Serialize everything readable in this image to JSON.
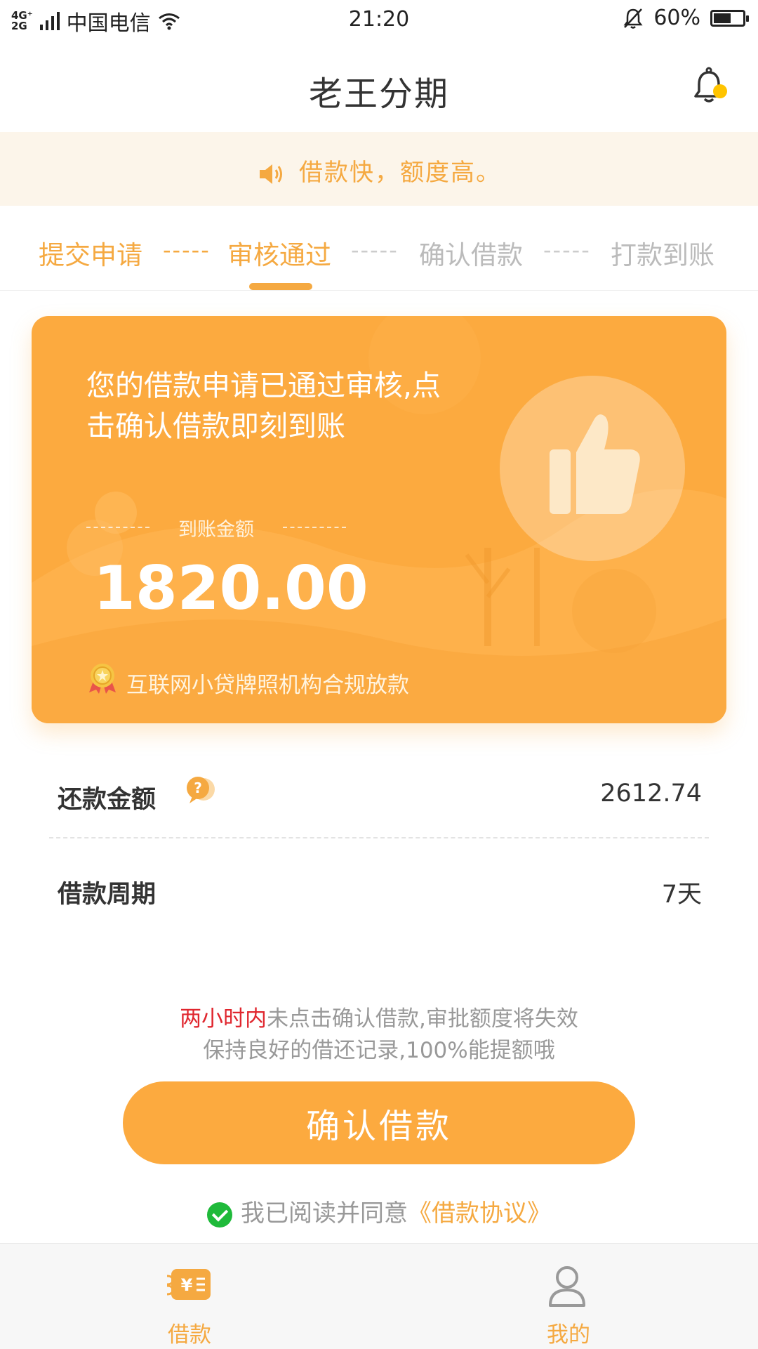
{
  "status_bar": {
    "network_type": "4G⁺\n2G",
    "carrier": "中国电信",
    "time": "21:20",
    "battery": "60%",
    "battery_level": 0.6
  },
  "header": {
    "title": "老王分期"
  },
  "notice": {
    "text": "借款快，额度高。"
  },
  "steps": [
    {
      "label": "提交申请",
      "state": "done"
    },
    {
      "label": "审核通过",
      "state": "done"
    },
    {
      "label": "确认借款",
      "state": "pending"
    },
    {
      "label": "打款到账",
      "state": "pending"
    }
  ],
  "step_separator": "-----",
  "card": {
    "title": "您的借款申请已通过审核,点击确认借款即刻到账",
    "amount_label": "到账金额",
    "amount": "1820.00",
    "footnote": "互联网小贷牌照机构合规放款"
  },
  "details": {
    "repay_label": "还款金额",
    "repay_value": "2612.74",
    "period_label": "借款周期",
    "period_value": "7天"
  },
  "warning": {
    "highlight": "两小时内",
    "text": "未点击确认借款,审批额度将失效",
    "line2": "保持良好的借还记录,100%能提额哦"
  },
  "confirm_button": "确认借款",
  "agreement": {
    "prefix": "我已阅读并同意",
    "link": "《借款协议》"
  },
  "tabs": [
    {
      "label": "借款",
      "icon": "loan-icon",
      "active": true
    },
    {
      "label": "我的",
      "icon": "profile-icon",
      "active": false
    }
  ],
  "colors": {
    "accent": "#f5a941",
    "card": "#fcaa3f",
    "notice_bg": "#fcf5ea",
    "warning_red": "#e0262e",
    "check_green": "#1fba3a"
  }
}
